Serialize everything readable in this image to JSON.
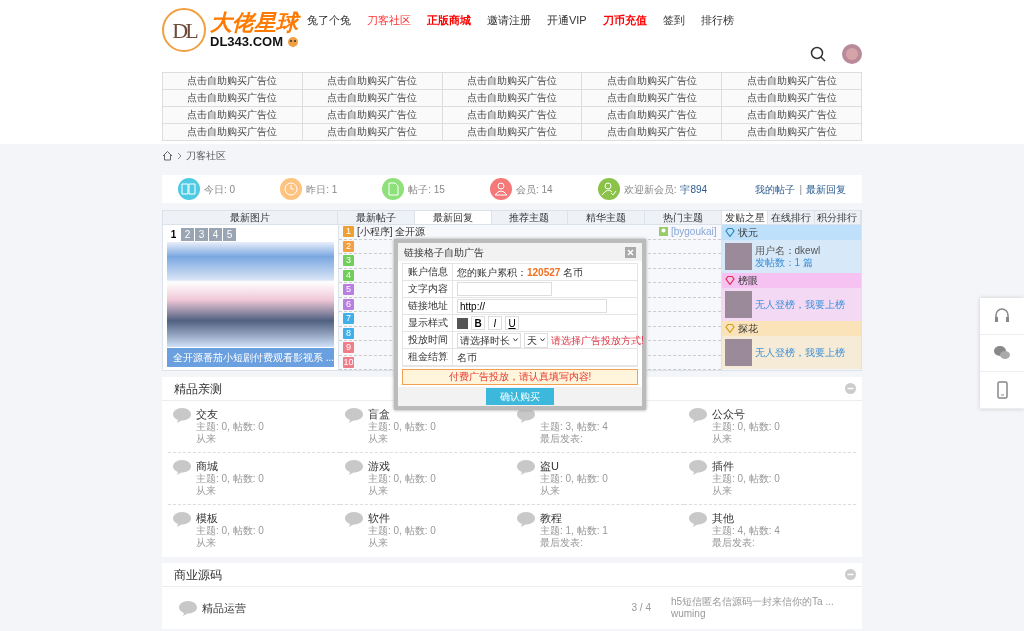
{
  "header": {
    "logo_mark": "DL",
    "logo_title": "大佬星球",
    "logo_domain": "DL343.COM",
    "nav": [
      {
        "label": "兔了个兔",
        "kind": "plain"
      },
      {
        "label": "刀客社区",
        "kind": "red"
      },
      {
        "label": "正版商城",
        "kind": "hot"
      },
      {
        "label": "邀请注册",
        "kind": "plain"
      },
      {
        "label": "开通VIP",
        "kind": "plain"
      },
      {
        "label": "刀币充值",
        "kind": "hot"
      },
      {
        "label": "签到",
        "kind": "plain"
      },
      {
        "label": "排行榜",
        "kind": "plain"
      }
    ]
  },
  "ads": [
    [
      "点击自助购买广告位",
      "点击自助购买广告位",
      "点击自助购买广告位",
      "点击自助购买广告位",
      "点击自助购买广告位"
    ],
    [
      "点击自助购买广告位",
      "点击自助购买广告位",
      "点击自助购买广告位",
      "点击自助购买广告位",
      "点击自助购买广告位"
    ],
    [
      "点击自助购买广告位",
      "点击自助购买广告位",
      "点击自助购买广告位",
      "点击自助购买广告位",
      "点击自助购买广告位"
    ],
    [
      "点击自助购买广告位",
      "点击自助购买广告位",
      "点击自助购买广告位",
      "点击自助购买广告位",
      "点击自助购买广告位"
    ]
  ],
  "breadcrumb": [
    "刀客社区"
  ],
  "stats": [
    {
      "kind": "book",
      "label": "今日: 0",
      "color": "#4ecbe3"
    },
    {
      "kind": "clock",
      "label": "昨日: 1",
      "color": "#fdc37f"
    },
    {
      "kind": "doc",
      "label": "帖子: 15",
      "color": "#8ee07a"
    },
    {
      "kind": "user",
      "label": "会员: 14",
      "color": "#f6797a"
    },
    {
      "kind": "newuser",
      "label": "欢迎新会员: ",
      "link": "宇894",
      "color": "#8bc34a"
    }
  ],
  "stat_links": {
    "items": [
      "我的帖子",
      "最新回复"
    ],
    "separator": "|"
  },
  "picture_tab": "最新图片",
  "post_tabs": [
    {
      "label": "最新帖子",
      "selected": false
    },
    {
      "label": "最新回复",
      "selected": true
    },
    {
      "label": "推荐主题",
      "selected": false
    },
    {
      "label": "精华主题",
      "selected": false
    },
    {
      "label": "热门主题",
      "selected": false
    }
  ],
  "rank_tabs": [
    {
      "label": "发贴之星",
      "selected": true
    },
    {
      "label": "在线排行",
      "selected": false
    },
    {
      "label": "积分排行",
      "selected": false
    }
  ],
  "slideshow": {
    "pages": [
      {
        "label": "1",
        "selected": true
      },
      {
        "label": "2",
        "selected": false
      },
      {
        "label": "3",
        "selected": false
      },
      {
        "label": "4",
        "selected": false
      },
      {
        "label": "5",
        "selected": false
      }
    ],
    "caption": "全开源番茄小短剧付费观看影视系 ..."
  },
  "posts": [
    {
      "num": "1",
      "color": "#f0a030",
      "title": "[小程序] 全开源",
      "author": "[bygoukai]"
    },
    {
      "num": "2",
      "color": "#f5a040"
    },
    {
      "num": "3",
      "color": "#6fcf5a"
    },
    {
      "num": "4",
      "color": "#6fcf5a"
    },
    {
      "num": "5",
      "color": "#b87fe0"
    },
    {
      "num": "6",
      "color": "#b87fe0"
    },
    {
      "num": "7",
      "color": "#3fb0ea"
    },
    {
      "num": "8",
      "color": "#3fb0ea"
    },
    {
      "num": "9",
      "color": "#ef7d8a"
    },
    {
      "num": "10",
      "color": "#ef7d8a"
    }
  ],
  "stars": [
    {
      "rank": "状元",
      "color": "#bfe0fa",
      "kind": "user",
      "user": "用户名：dkewl",
      "count": "发帖数：1 篇"
    },
    {
      "rank": "榜眼",
      "color": "#f5c2f2",
      "kind": "empty",
      "text": "无人登榜，我要上榜"
    },
    {
      "rank": "探花",
      "color": "#fae3b8",
      "kind": "empty",
      "text": "无人登榜，我要上榜"
    }
  ],
  "sections": [
    {
      "title": "精品亲测",
      "kind": "grid",
      "forums": [
        {
          "name": "交友",
          "stats": "主题: 0, 帖数: 0",
          "last": "从来"
        },
        {
          "name": "盲盒",
          "stats": "主题: 0, 帖数: 0",
          "last": "从来"
        },
        {
          "stats": "主题: 3, 帖数: 4",
          "last": "最后发表:"
        },
        {
          "name": "公众号",
          "stats": "主题: 0, 帖数: 0",
          "last": "从来"
        },
        {
          "name": "商城",
          "stats": "主题: 0, 帖数: 0",
          "last": "从来"
        },
        {
          "name": "游戏",
          "stats": "主题: 0, 帖数: 0",
          "last": "从来"
        },
        {
          "name": "盗U",
          "stats": "主题: 0, 帖数: 0",
          "last": "从来"
        },
        {
          "name": "插件",
          "stats": "主题: 0, 帖数: 0",
          "last": "从来"
        },
        {
          "name": "模板",
          "stats": "主题: 0, 帖数: 0",
          "last": "从来"
        },
        {
          "name": "软件",
          "stats": "主题: 0, 帖数: 0",
          "last": "从来"
        },
        {
          "name": "教程",
          "stats": "主题: 1, 帖数: 1",
          "last": "最后发表:"
        },
        {
          "name": "其他",
          "stats": "主题: 4, 帖数: 4",
          "last": "最后发表:"
        }
      ]
    },
    {
      "title": "商业源码",
      "kind": "list",
      "forums": [
        {
          "name": "精品运营",
          "count": "3 / 4",
          "latest": "h5短信匿名信源码一封来信你的Ta ...",
          "author": "wuming"
        }
      ]
    }
  ],
  "modal": {
    "title": "链接格子自助广告",
    "rows": [
      {
        "kind": "text",
        "label": "账户信息",
        "prefix": "您的账户累积：",
        "amount": "120527",
        "suffix": "名币"
      },
      {
        "kind": "input",
        "label": "文字内容"
      },
      {
        "kind": "input",
        "label": "链接地址",
        "value": "http://"
      },
      {
        "kind": "style",
        "label": "显示样式",
        "buttons": [
          "B",
          "I",
          "U"
        ]
      },
      {
        "kind": "time",
        "label": "投放时间",
        "selects": [
          "请选择时长",
          "天"
        ],
        "hint": "请选择广告投放方式!"
      },
      {
        "kind": "text",
        "label": "租金结算",
        "suffix": "名币"
      }
    ],
    "notice": "付费广告投放，请认真填写内容!",
    "submit": "确认购买"
  }
}
